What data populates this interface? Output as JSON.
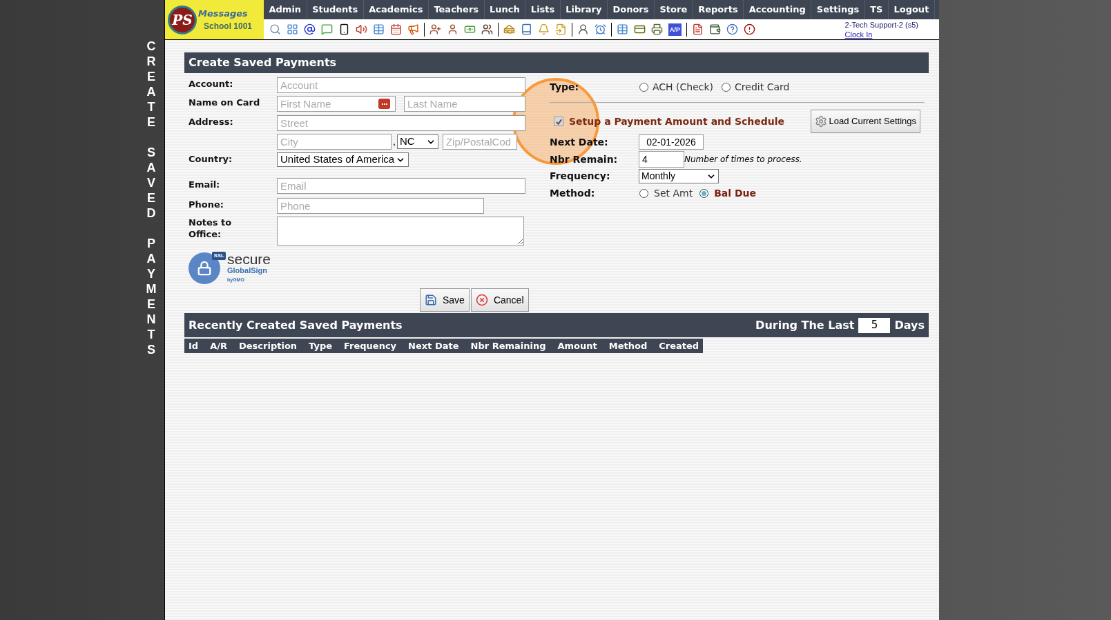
{
  "side_title": "CREATE SAVED PAYMENTS",
  "logo": {
    "monogram": "PS",
    "name": "Messages",
    "school": "School 1001"
  },
  "nav": [
    {
      "label": "Admin"
    },
    {
      "label": "Students"
    },
    {
      "label": "Academics"
    },
    {
      "label": "Teachers"
    },
    {
      "label": "Lunch"
    },
    {
      "label": "Lists"
    },
    {
      "label": "Library"
    },
    {
      "label": "Donors"
    },
    {
      "label": "Store"
    },
    {
      "label": "Reports"
    },
    {
      "label": "Accounting"
    },
    {
      "label": "Settings"
    },
    {
      "label": "TS"
    },
    {
      "label": "Logout"
    }
  ],
  "toolbar_badge": "A/P",
  "user": {
    "name": "2-Tech Support-2 (s5)",
    "link": "Clock In"
  },
  "form": {
    "title": "Create Saved Payments",
    "account": {
      "label": "Account:",
      "placeholder": "Account"
    },
    "name": {
      "label": "Name on Card",
      "first_placeholder": "First Name",
      "last_placeholder": "Last Name"
    },
    "address": {
      "label": "Address:",
      "street_placeholder": "Street",
      "city_placeholder": "City",
      "separator": ",",
      "state": "NC",
      "zip_placeholder": "Zip/PostalCod"
    },
    "country": {
      "label": "Country:",
      "value": "United States of America"
    },
    "email": {
      "label": "Email:",
      "placeholder": "Email"
    },
    "phone": {
      "label": "Phone:",
      "placeholder": "Phone"
    },
    "notes": {
      "label": "Notes to Office:"
    },
    "seal": {
      "badge": "SSL",
      "word": "secure",
      "brand": "GlobalSign",
      "by": "byGMO"
    },
    "type": {
      "label": "Type:",
      "options": [
        {
          "label": "ACH (Check)",
          "selected": false
        },
        {
          "label": "Credit Card",
          "selected": false
        }
      ]
    },
    "setup": {
      "label": "Setup a Payment Amount and Schedule",
      "checked": true,
      "disabled": true
    },
    "load_button": "Load Current Settings",
    "next_date": {
      "label": "Next Date:",
      "value": "02-01-2026"
    },
    "nbr_remain": {
      "label": "Nbr Remain:",
      "value": "4",
      "hint": "Number of times to process."
    },
    "frequency": {
      "label": "Frequency:",
      "value": "Monthly"
    },
    "method": {
      "label": "Method:",
      "options": [
        {
          "label": "Set Amt",
          "selected": false
        },
        {
          "label": "Bal Due",
          "selected": true
        }
      ]
    },
    "buttons": [
      {
        "kind": "save",
        "label": "Save"
      },
      {
        "kind": "cancel",
        "label": "Cancel"
      }
    ]
  },
  "recent": {
    "title": "Recently Created Saved Payments",
    "during": "During The Last",
    "days_value": "5",
    "days": "Days",
    "columns": [
      "Id",
      "A/R",
      "Description",
      "Type",
      "Frequency",
      "Next Date",
      "Nbr Remaining",
      "Amount",
      "Method",
      "Created"
    ]
  }
}
